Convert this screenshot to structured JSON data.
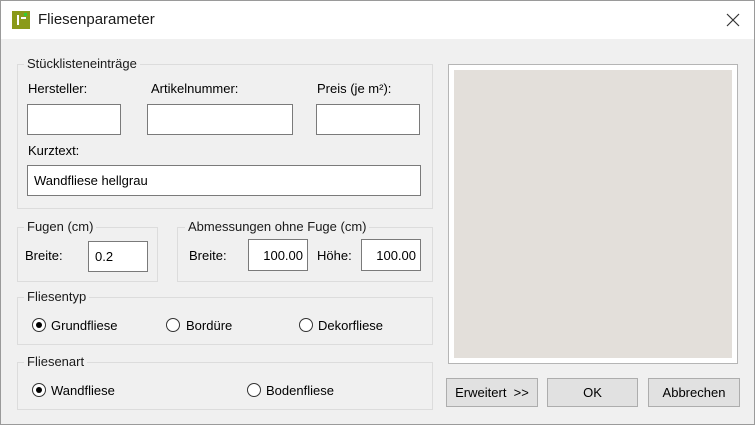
{
  "window": {
    "title": "Fliesenparameter"
  },
  "bom": {
    "group_title": "Stücklisteneinträge",
    "manufacturer_label": "Hersteller:",
    "manufacturer_value": "",
    "article_label": "Artikelnummer:",
    "article_value": "",
    "price_label": "Preis (je m²):",
    "price_value": "",
    "shorttext_label": "Kurztext:",
    "shorttext_value": "Wandfliese hellgrau"
  },
  "joints": {
    "group_title": "Fugen (cm)",
    "width_label": "Breite:",
    "width_value": "0.2"
  },
  "dimensions": {
    "group_title": "Abmessungen ohne Fuge (cm)",
    "width_label": "Breite:",
    "width_value": "100.00",
    "height_label": "Höhe:",
    "height_value": "100.00"
  },
  "tile_type": {
    "group_title": "Fliesentyp",
    "options": [
      "Grundfliese",
      "Bordüre",
      "Dekorfliese"
    ],
    "selected": "Grundfliese"
  },
  "tile_kind": {
    "group_title": "Fliesenart",
    "options": [
      "Wandfliese",
      "Bodenfliese"
    ],
    "selected": "Wandfliese"
  },
  "preview": {
    "color": "#e3dfda"
  },
  "buttons": {
    "advanced": "Erweitert  >>",
    "ok": "OK",
    "cancel": "Abbrechen"
  },
  "icons": {
    "app": "tile-app-icon",
    "close": "close-icon"
  }
}
